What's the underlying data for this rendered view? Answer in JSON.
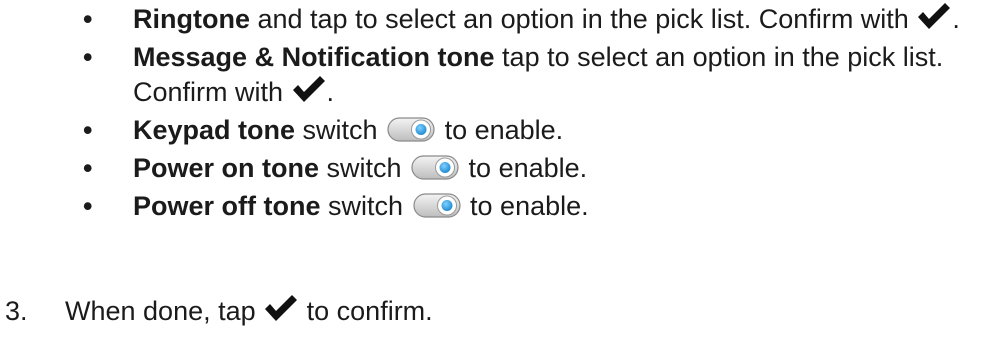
{
  "bullets": [
    {
      "bold": "Ringtone",
      "text": " and tap to select an option in the pick list. Confirm with ",
      "icon": "checkmark-icon",
      "after": "."
    },
    {
      "bold": "Message & Notification tone",
      "text": " tap to select an option in the pick list. Confirm with ",
      "icon": "checkmark-icon",
      "after": "."
    },
    {
      "bold": "Keypad tone",
      "text": " switch ",
      "icon": "toggle-switch-icon",
      "after": " to enable."
    },
    {
      "bold": "Power on tone",
      "text": " switch ",
      "icon": "toggle-switch-icon",
      "after": " to enable."
    },
    {
      "bold": "Power off tone",
      "text": " switch ",
      "icon": "toggle-switch-icon",
      "after": " to enable."
    }
  ],
  "bullet_symbol": "•",
  "step": {
    "number": "3.",
    "text_before": "When done, tap ",
    "icon": "checkmark-icon",
    "text_after": " to confirm."
  },
  "colors": {
    "text": "#1b1b1b",
    "check": "#111111",
    "toggle_track": "#d8d8d8",
    "toggle_knob": "#2a9be0"
  }
}
